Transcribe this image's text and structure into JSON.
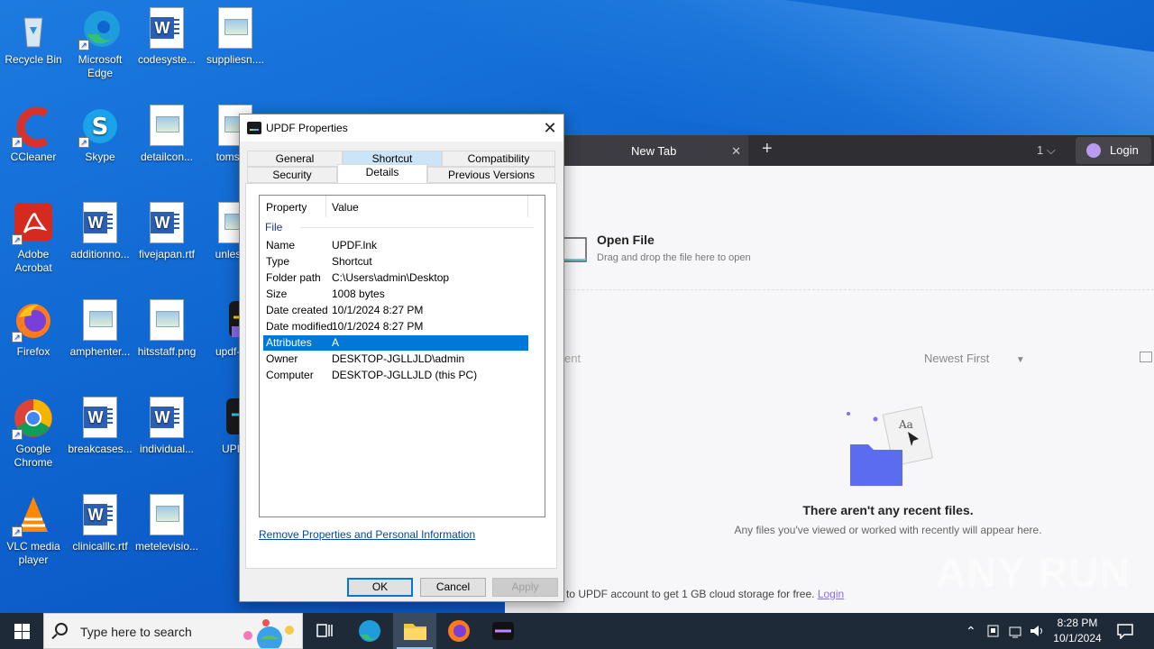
{
  "desktop": {
    "icons": [
      {
        "label": "Recycle Bin"
      },
      {
        "label": "Microsoft Edge"
      },
      {
        "label": "codesyste..."
      },
      {
        "label": "suppliesn...."
      },
      {
        "label": "CCleaner"
      },
      {
        "label": "Skype"
      },
      {
        "label": "detailcon..."
      },
      {
        "label": "tomse..."
      },
      {
        "label": "Adobe Acrobat"
      },
      {
        "label": "additionno..."
      },
      {
        "label": "fivejapan.rtf"
      },
      {
        "label": "unless..."
      },
      {
        "label": "Firefox"
      },
      {
        "label": "amphenter..."
      },
      {
        "label": "hitsstaff.png"
      },
      {
        "label": "updf-9..."
      },
      {
        "label": "Google Chrome"
      },
      {
        "label": "breakcases..."
      },
      {
        "label": "individual..."
      },
      {
        "label": "UPI..."
      },
      {
        "label": "VLC media player"
      },
      {
        "label": "clinicalllc.rtf"
      },
      {
        "label": "metelevisio..."
      }
    ]
  },
  "updf_window": {
    "tab_title": "New Tab",
    "tab_close": "✕",
    "new_tab": "+",
    "tab_count": "1",
    "login_label": "Login",
    "open_file_title": "Open File",
    "open_file_subtitle": "Drag and drop the file here to open",
    "recent_partial": "ent",
    "sort_label": "Newest First",
    "empty_title": "There aren't any recent files.",
    "empty_subtitle": "Any files you've viewed or worked with recently will appear here.",
    "promo_text": "n to UPDF account to get 1 GB cloud storage for free.",
    "promo_link": "Login"
  },
  "watermark": "ANY RUN",
  "dialog": {
    "title": "UPDF Properties",
    "tabs_row1": [
      "General",
      "Shortcut",
      "Compatibility"
    ],
    "tabs_row2": [
      "Security",
      "Details",
      "Previous Versions"
    ],
    "active_tab": "Details",
    "columns": [
      "Property",
      "Value"
    ],
    "group": "File",
    "properties": [
      {
        "k": "Name",
        "v": "UPDF.lnk"
      },
      {
        "k": "Type",
        "v": "Shortcut"
      },
      {
        "k": "Folder path",
        "v": "C:\\Users\\admin\\Desktop"
      },
      {
        "k": "Size",
        "v": "1008 bytes"
      },
      {
        "k": "Date created",
        "v": "10/1/2024 8:27 PM"
      },
      {
        "k": "Date modified",
        "v": "10/1/2024 8:27 PM"
      },
      {
        "k": "Attributes",
        "v": "A"
      },
      {
        "k": "Owner",
        "v": "DESKTOP-JGLLJLD\\admin"
      },
      {
        "k": "Computer",
        "v": "DESKTOP-JGLLJLD (this PC)"
      }
    ],
    "selected_row": "Attributes",
    "remove_link": "Remove Properties and Personal Information",
    "buttons": {
      "ok": "OK",
      "cancel": "Cancel",
      "apply": "Apply"
    }
  },
  "taskbar": {
    "search_placeholder": "Type here to search",
    "time": "8:28 PM",
    "date": "10/1/2024"
  },
  "colors": {
    "desktop_blue": "#0f66d0",
    "selection": "#0078d7",
    "taskbar": "#1f2a38"
  }
}
